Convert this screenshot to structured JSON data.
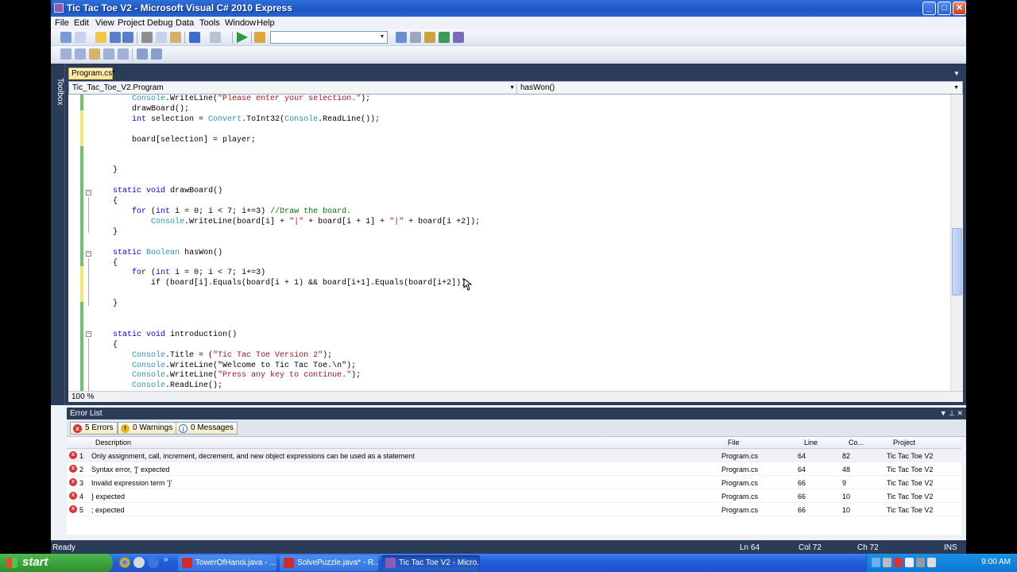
{
  "window": {
    "title": "Tic Tac Toe V2 - Microsoft Visual C# 2010 Express"
  },
  "menu": [
    "File",
    "Edit",
    "View",
    "Project",
    "Debug",
    "Data",
    "Tools",
    "Window",
    "Help"
  ],
  "toolbox_label": "Toolbox",
  "tab": {
    "label": "Program.cs*"
  },
  "nav": {
    "left": "Tic_Tac_Toe_V2.Program",
    "right": "hasWon()"
  },
  "zoom": "100 %",
  "code_lines": [
    "        Console.WriteLine(\"Please enter your selection.\");",
    "        drawBoard();",
    "        int selection = Convert.ToInt32(Console.ReadLine());",
    "",
    "        board[selection] = player;",
    "",
    "",
    "    }",
    "",
    "    static void drawBoard()",
    "    {",
    "        for (int i = 0; i < 7; i+=3) //Draw the board.",
    "            Console.WriteLine(board[i] + \"|\" + board[i + 1] + \"|\" + board[i +2]);",
    "    }",
    "",
    "    static Boolean hasWon()",
    "    {",
    "        for (int i = 0; i < 7; i+=3)",
    "            if (board[i].Equals(board[i + 1) && board[i+1].Equals(board[i+2]))",
    "",
    "    }",
    "",
    "",
    "    static void introduction()",
    "    {",
    "        Console.Title = (\"Tic Tac Toe Version 2\");",
    "        Console.WriteLine(\"Welcome to Tic Tac Toe.\\n\");",
    "        Console.WriteLine(\"Press any key to continue.\");",
    "        Console.ReadLine();"
  ],
  "error_list": {
    "title": "Error List",
    "filters": {
      "errors": "5 Errors",
      "warnings": "0 Warnings",
      "messages": "0 Messages"
    },
    "columns": [
      "Description",
      "File",
      "Line",
      "Co...",
      "Project"
    ],
    "rows": [
      {
        "n": "1",
        "description": "Only assignment, call, increment, decrement, and new object expressions can be used as a statement",
        "file": "Program.cs",
        "line": "64",
        "col": "82",
        "project": "Tic Tac Toe V2"
      },
      {
        "n": "2",
        "description": "Syntax error, ']' expected",
        "file": "Program.cs",
        "line": "64",
        "col": "48",
        "project": "Tic Tac Toe V2"
      },
      {
        "n": "3",
        "description": "Invalid expression term '}'",
        "file": "Program.cs",
        "line": "66",
        "col": "9",
        "project": "Tic Tac Toe V2"
      },
      {
        "n": "4",
        "description": "} expected",
        "file": "Program.cs",
        "line": "66",
        "col": "10",
        "project": "Tic Tac Toe V2"
      },
      {
        "n": "5",
        "description": "; expected",
        "file": "Program.cs",
        "line": "66",
        "col": "10",
        "project": "Tic Tac Toe V2"
      }
    ]
  },
  "status": {
    "ready": "Ready",
    "ln": "Ln 64",
    "col": "Col 72",
    "ch": "Ch 72",
    "ins": "INS"
  },
  "taskbar": {
    "start": "start",
    "tasks": [
      "TowerOfHanoi.java - ...",
      "SolvePuzzle.java* - R...",
      "Tic Tac Toe V2 - Micro..."
    ],
    "clock": "9:00 AM"
  }
}
